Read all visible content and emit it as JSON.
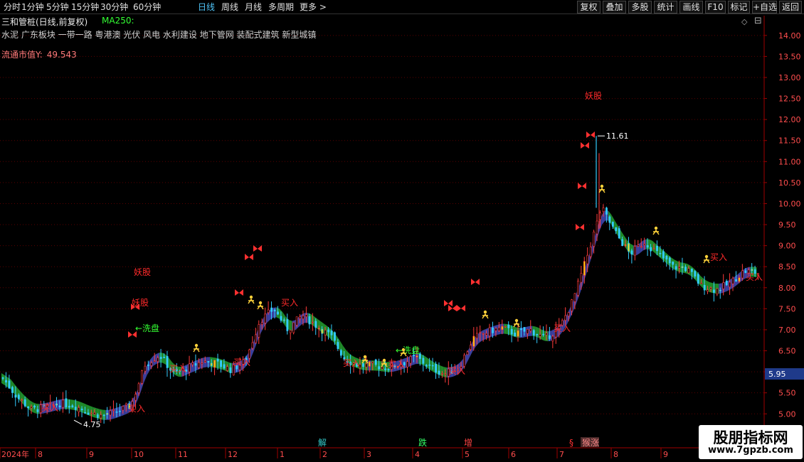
{
  "toolbar": {
    "timeframes": [
      {
        "label": "分时",
        "active": false
      },
      {
        "label": "1分钟",
        "active": false
      },
      {
        "label": "5分钟",
        "active": false
      },
      {
        "label": "15分钟",
        "active": false
      },
      {
        "label": "30分钟",
        "active": false
      },
      {
        "label": "60分钟",
        "active": false
      },
      {
        "label": "日线",
        "active": true
      },
      {
        "label": "周线",
        "active": false
      },
      {
        "label": "月线",
        "active": false
      },
      {
        "label": "多周期",
        "active": false
      },
      {
        "label": "更多 >",
        "active": false
      }
    ],
    "buttons": [
      "复权",
      "叠加",
      "多股",
      "统计",
      "画线",
      "F10",
      "标记",
      "+自选",
      "返回"
    ]
  },
  "stock": {
    "title": "三和管桩(日线,前复权)",
    "ma_label": "MA250:",
    "tags": "水泥 广东板块 一带一路 粤港澳 光伏 风电 水利建设 地下管网 装配式建筑 新型城镇",
    "float_cap_label": "流通市值Y:",
    "float_cap_value": "49.543"
  },
  "chart_data": {
    "type": "candlestick",
    "ylim": [
      4.7,
      14.2
    ],
    "y_ticks": [
      "14.00",
      "13.50",
      "13.00",
      "12.50",
      "12.00",
      "11.50",
      "11.00",
      "10.50",
      "10.00",
      "9.50",
      "9.00",
      "8.50",
      "8.00",
      "7.50",
      "7.00",
      "6.50",
      "6.00",
      "5.50",
      "5.00"
    ],
    "current_price": "5.95",
    "high_label": "11.61",
    "low_label": "4.75",
    "x_labels": [
      "2024年",
      "8",
      "9",
      "10",
      "11",
      "12",
      "1",
      "2",
      "3",
      "4",
      "5",
      "6",
      "7",
      "8",
      "9"
    ],
    "close_path": [
      5.85,
      5.4,
      5.1,
      5.15,
      5.25,
      5.2,
      5.05,
      4.95,
      5.05,
      5.2,
      6.2,
      6.4,
      5.95,
      6.1,
      6.25,
      6.2,
      6.05,
      6.25,
      7.2,
      7.5,
      7.0,
      7.35,
      7.1,
      6.85,
      6.3,
      6.15,
      6.15,
      6.1,
      6.2,
      6.35,
      6.1,
      5.95,
      6.1,
      6.8,
      6.95,
      7.05,
      6.9,
      7.0,
      6.8,
      7.0,
      7.7,
      8.75,
      9.9,
      9.3,
      8.8,
      9.1,
      8.8,
      8.5,
      8.45,
      8.05,
      7.95,
      8.1,
      8.4,
      8.35
    ],
    "annotations_red": [
      "妖股",
      "妖股",
      "妖股",
      "买入",
      "买入",
      "买入",
      "买入",
      "买入",
      "买入",
      "买入",
      "买入",
      "买入",
      "买入",
      "买入"
    ],
    "annotations_green": [
      "洗盘",
      "洗盘"
    ],
    "bottom_markers": [
      {
        "text": "解",
        "color": "#33cccc"
      },
      {
        "text": "跌",
        "color": "#33ff66"
      },
      {
        "text": "增",
        "color": "#ff4444"
      },
      {
        "text": "§",
        "color": "#ff3333"
      },
      {
        "text": "猴涨",
        "color": "#ff8888"
      }
    ]
  },
  "watermark": {
    "text": "股朋指标网",
    "url": "www.7gpzb.com"
  },
  "icons": {
    "diamond": "◇",
    "collapse": "⊟"
  }
}
